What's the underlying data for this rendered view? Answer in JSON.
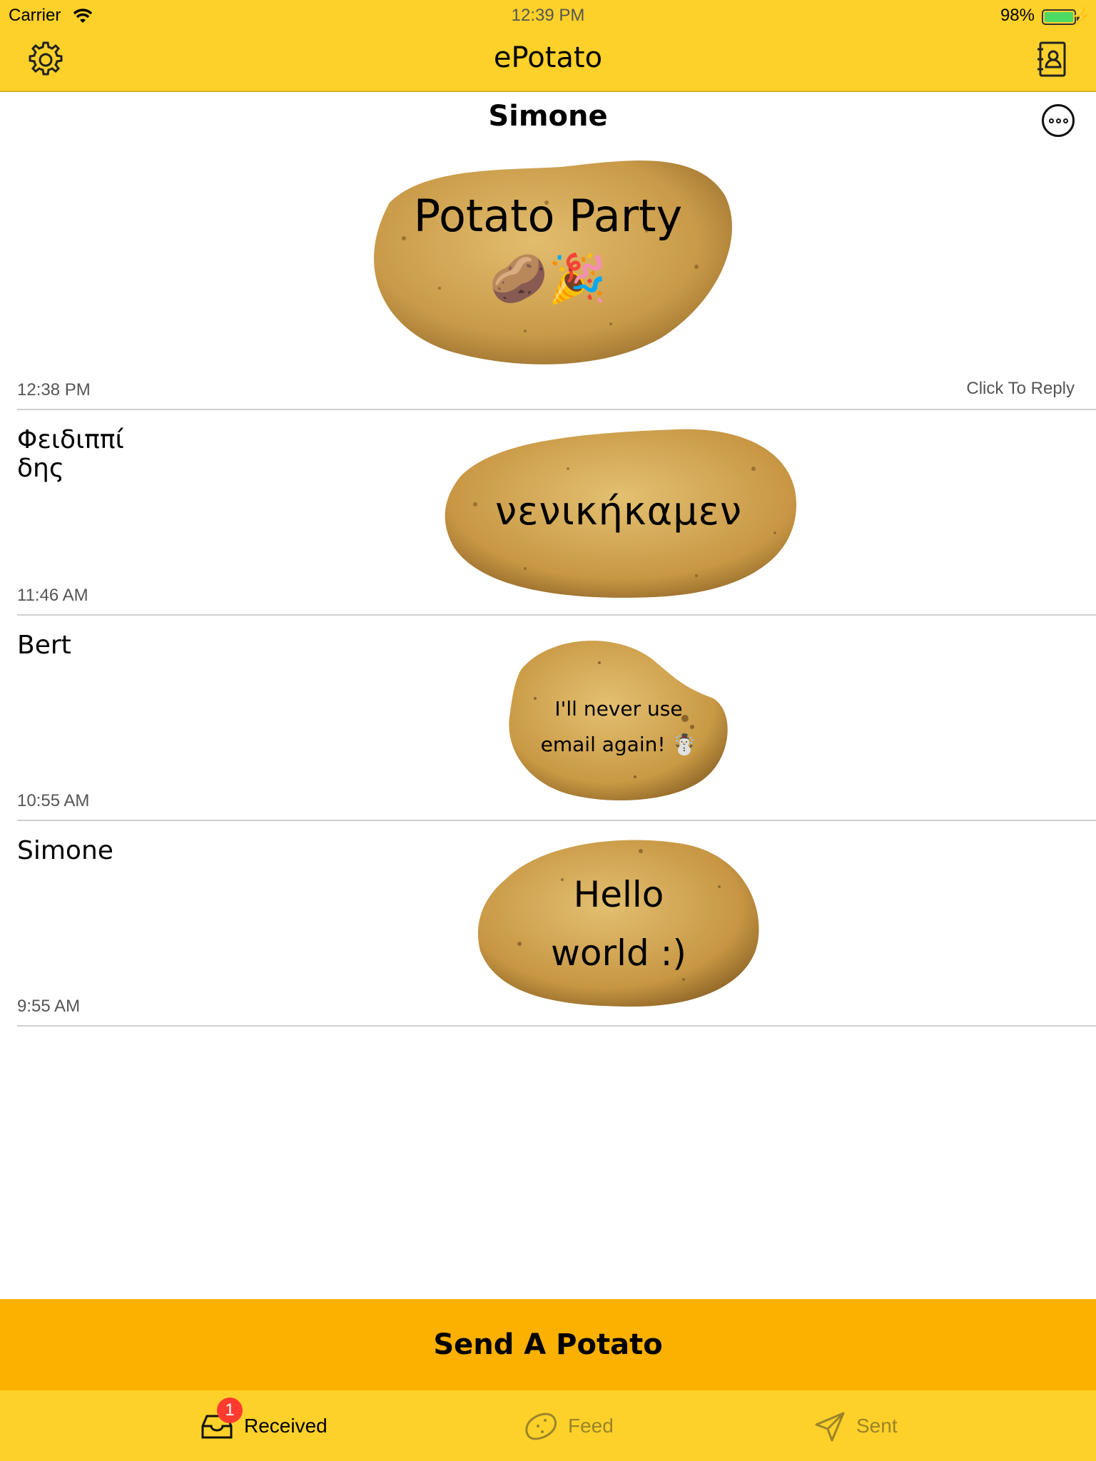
{
  "status_bar": {
    "carrier": "Carrier",
    "time": "12:39 PM",
    "battery": "98%"
  },
  "nav": {
    "title": "ePotato",
    "left_icon": "gear-icon",
    "right_icon": "contacts-book-icon"
  },
  "feed": [
    {
      "sender": "Simone",
      "message": "Potato Party",
      "emoji": "🥔🎉",
      "time": "12:38 PM",
      "reply": "Click To Reply"
    },
    {
      "sender": "Φειδιππί δης",
      "message": "νενικήκαμεν",
      "time": "11:46 AM"
    },
    {
      "sender": "Bert",
      "message": "I'll never use email again! ☃️",
      "time": "10:55 AM"
    },
    {
      "sender": "Simone",
      "message": "Hello world :)",
      "time": "9:55 AM"
    }
  ],
  "send_button": "Send A Potato",
  "tabs": {
    "received": {
      "label": "Received",
      "badge": "1",
      "icon": "inbox-tray-icon"
    },
    "feed": {
      "label": "Feed",
      "icon": "potato-icon"
    },
    "sent": {
      "label": "Sent",
      "icon": "paper-plane-icon"
    }
  },
  "colors": {
    "bar_yellow": "#fed12a",
    "send_orange": "#fcb000",
    "badge_red": "#ff3b30",
    "potato": "#c99a48"
  }
}
